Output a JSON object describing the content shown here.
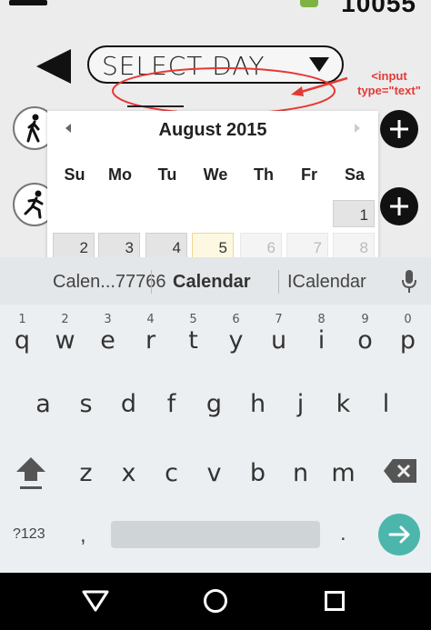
{
  "status": {
    "number": "10055"
  },
  "header": {
    "select_label": "SELECT DAY"
  },
  "annotation": {
    "line1": "<input",
    "line2": "type=\"text\""
  },
  "calendar": {
    "month": "August 2015",
    "weekdays": [
      "Su",
      "Mo",
      "Tu",
      "We",
      "Th",
      "Fr",
      "Sa"
    ],
    "row1": [
      "1"
    ],
    "row2": [
      "2",
      "3",
      "4",
      "5",
      "6",
      "7",
      "8"
    ],
    "today": "5"
  },
  "keyboard": {
    "suggestions": [
      "Calen...77766",
      "Calendar",
      "ICalendar"
    ],
    "row1": [
      {
        "key": "q",
        "hint": "1"
      },
      {
        "key": "w",
        "hint": "2"
      },
      {
        "key": "e",
        "hint": "3"
      },
      {
        "key": "r",
        "hint": "4"
      },
      {
        "key": "t",
        "hint": "5"
      },
      {
        "key": "y",
        "hint": "6"
      },
      {
        "key": "u",
        "hint": "7"
      },
      {
        "key": "i",
        "hint": "8"
      },
      {
        "key": "o",
        "hint": "9"
      },
      {
        "key": "p",
        "hint": "0"
      }
    ],
    "row2": [
      "a",
      "s",
      "d",
      "f",
      "g",
      "h",
      "j",
      "k",
      "l"
    ],
    "row3": [
      "z",
      "x",
      "c",
      "v",
      "b",
      "n",
      "m"
    ],
    "symbols_label": "?123",
    "comma": ",",
    "period": "."
  },
  "colors": {
    "annotation": "#e53935",
    "enter": "#4db6ac",
    "today_bg": "#fdf8e2"
  }
}
